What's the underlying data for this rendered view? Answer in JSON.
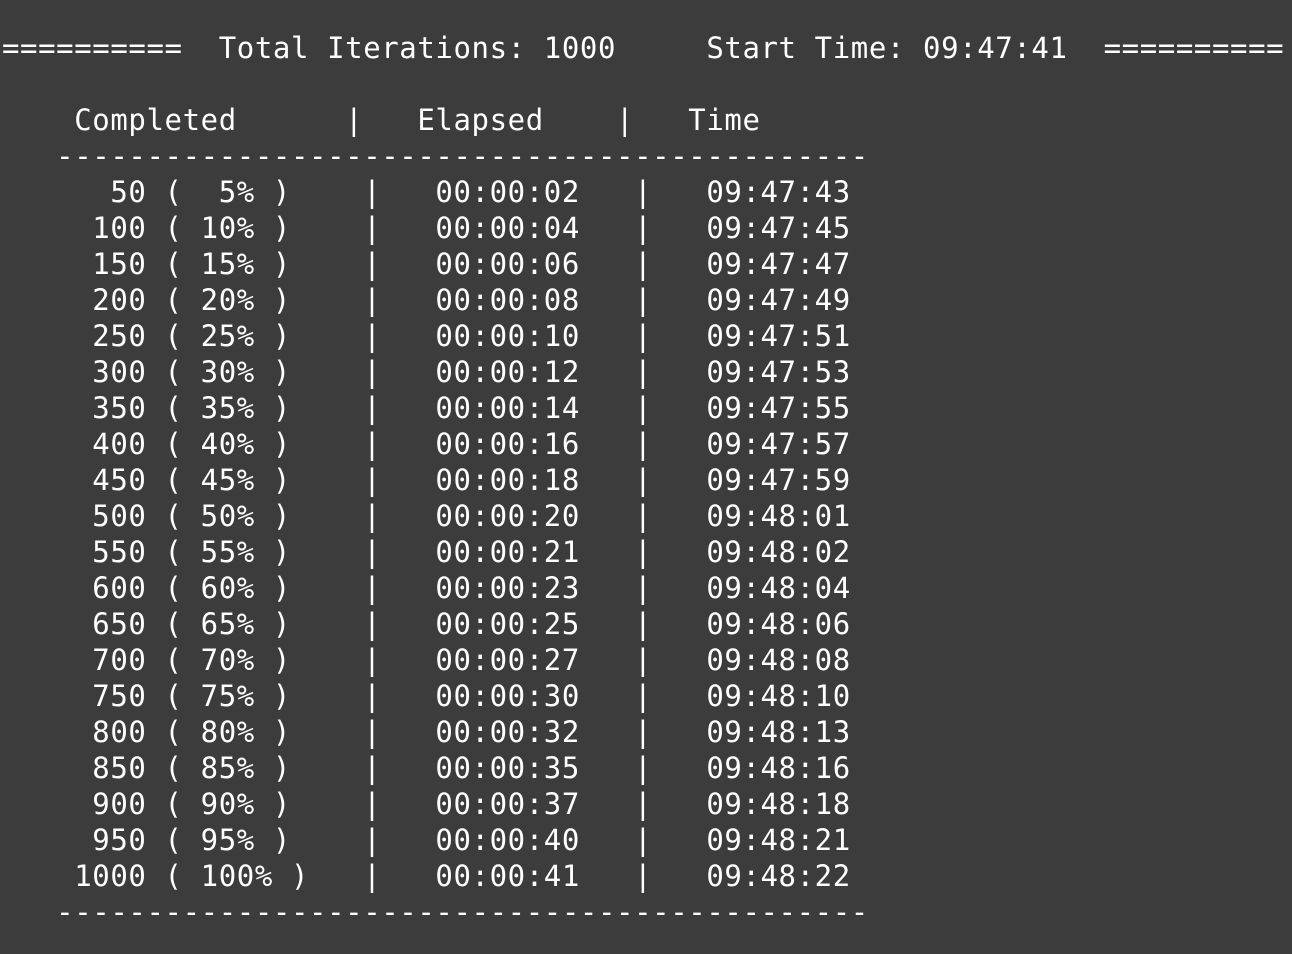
{
  "terminal": {
    "header": "==========  Total Iterations: 1000     Start Time: 09:47:41  ==========",
    "column_header": "    Completed      |   Elapsed    |   Time",
    "separator": "   ---------------------------------------------",
    "rows": [
      "      50 (  5% )    |   00:00:02   |   09:47:43",
      "     100 ( 10% )    |   00:00:04   |   09:47:45",
      "     150 ( 15% )    |   00:00:06   |   09:47:47",
      "     200 ( 20% )    |   00:00:08   |   09:47:49",
      "     250 ( 25% )    |   00:00:10   |   09:47:51",
      "     300 ( 30% )    |   00:00:12   |   09:47:53",
      "     350 ( 35% )    |   00:00:14   |   09:47:55",
      "     400 ( 40% )    |   00:00:16   |   09:47:57",
      "     450 ( 45% )    |   00:00:18   |   09:47:59",
      "     500 ( 50% )    |   00:00:20   |   09:48:01",
      "     550 ( 55% )    |   00:00:21   |   09:48:02",
      "     600 ( 60% )    |   00:00:23   |   09:48:04",
      "     650 ( 65% )    |   00:00:25   |   09:48:06",
      "     700 ( 70% )    |   00:00:27   |   09:48:08",
      "     750 ( 75% )    |   00:00:30   |   09:48:10",
      "     800 ( 80% )    |   00:00:32   |   09:48:13",
      "     850 ( 85% )    |   00:00:35   |   09:48:16",
      "     900 ( 90% )    |   00:00:37   |   09:48:18",
      "     950 ( 95% )    |   00:00:40   |   09:48:21",
      "    1000 ( 100% )   |   00:00:41   |   09:48:22"
    ],
    "footer_separator": "   ---------------------------------------------"
  }
}
